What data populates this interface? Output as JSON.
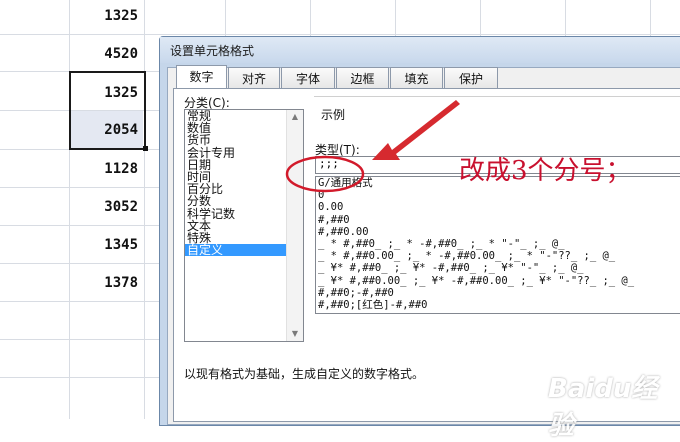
{
  "sheet": {
    "cells": [
      "1325",
      "4520",
      "1325",
      "2054",
      "1128",
      "3052",
      "1345",
      "1378"
    ]
  },
  "dialog": {
    "title": "设置单元格格式",
    "tabs": [
      "数字",
      "对齐",
      "字体",
      "边框",
      "填充",
      "保护"
    ],
    "active_tab": "数字",
    "category_label": "分类(C):",
    "categories": [
      "常规",
      "数值",
      "货币",
      "会计专用",
      "日期",
      "时间",
      "百分比",
      "分数",
      "科学记数",
      "文本",
      "特殊",
      "自定义"
    ],
    "selected_category": "自定义",
    "sample_label": "示例",
    "type_label": "类型(T):",
    "type_value": ";;;",
    "format_list": [
      "G/通用格式",
      "0",
      "0.00",
      "#,##0",
      "#,##0.00",
      "_ * #,##0_ ;_ * -#,##0_ ;_ * \"-\"_ ;_ @_",
      "_ * #,##0.00_ ;_ * -#,##0.00_ ;_ * \"-\"??_ ;_ @_",
      "_ ¥* #,##0_ ;_ ¥* -#,##0_ ;_ ¥* \"-\"_ ;_ @_",
      "_ ¥* #,##0.00_ ;_ ¥* -#,##0.00_ ;_ ¥* \"-\"??_ ;_ @_",
      "#,##0;-#,##0",
      "#,##0;[红色]-#,##0"
    ],
    "description": "以现有格式为基础，生成自定义的数字格式。"
  },
  "annotation": {
    "text": "改成3个分号；",
    "color": "#c8102e"
  },
  "watermark": "Baidu经验"
}
